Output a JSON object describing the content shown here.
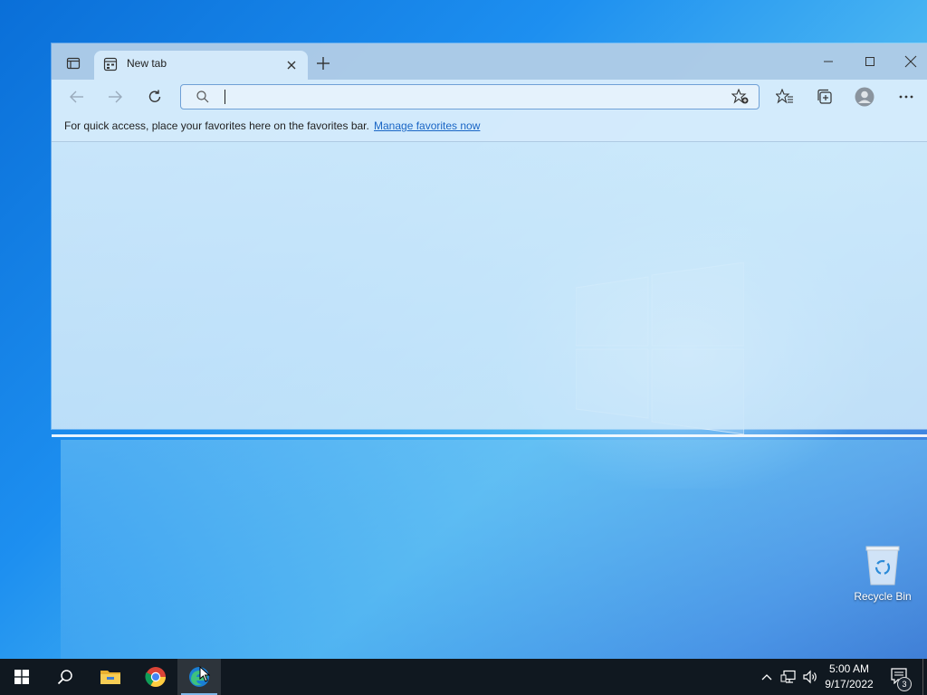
{
  "browser": {
    "tab": {
      "title": "New tab"
    },
    "address_bar": {
      "value": "",
      "placeholder": ""
    },
    "favorites_bar": {
      "message": "For quick access, place your favorites here on the favorites bar.",
      "link": "Manage favorites now"
    }
  },
  "desktop": {
    "icons": [
      {
        "label": "Recycle Bin"
      }
    ]
  },
  "taskbar": {
    "apps": [
      "start-icon",
      "search-icon",
      "file-explorer-icon",
      "chrome-icon",
      "edge-icon"
    ],
    "active_app": "edge",
    "clock": {
      "time": "5:00 AM",
      "date": "9/17/2022"
    },
    "notifications": {
      "count": "3"
    }
  },
  "colors": {
    "accent": "#1a66c5",
    "taskbar": "#101820"
  }
}
